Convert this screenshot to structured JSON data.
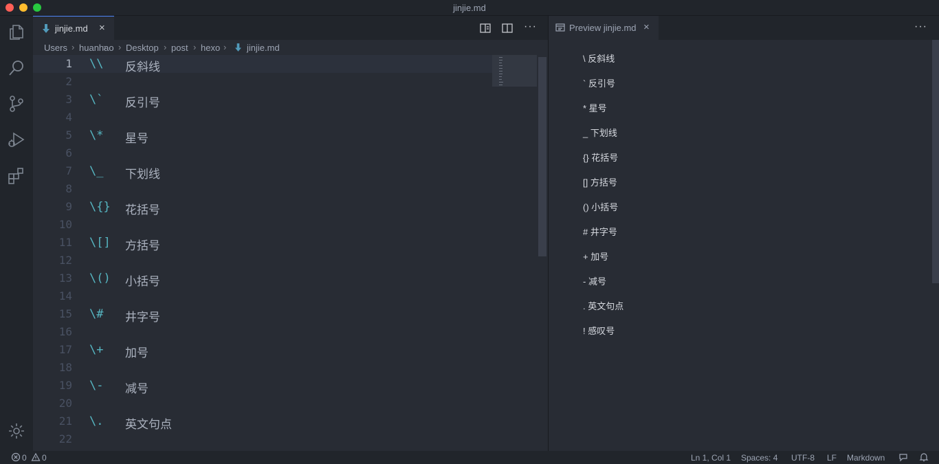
{
  "window": {
    "title": "jinjie.md"
  },
  "activity_bar": {
    "items": [
      "explorer-icon",
      "search-icon",
      "source-control-icon",
      "run-debug-icon",
      "extensions-icon"
    ],
    "bottom": "settings-gear-icon"
  },
  "editor": {
    "tab": {
      "label": "jinjie.md",
      "close": "×"
    },
    "more": "···",
    "breadcrumb": [
      "Users",
      "huanhao",
      "Desktop",
      "post",
      "hexo",
      "jinjie.md"
    ],
    "lines": [
      {
        "n": "1",
        "esc": "\\\\",
        "text": "反斜线"
      },
      {
        "n": "2",
        "esc": "",
        "text": ""
      },
      {
        "n": "3",
        "esc": "\\`",
        "text": "反引号"
      },
      {
        "n": "4",
        "esc": "",
        "text": ""
      },
      {
        "n": "5",
        "esc": "\\*",
        "text": "星号"
      },
      {
        "n": "6",
        "esc": "",
        "text": ""
      },
      {
        "n": "7",
        "esc": "\\_",
        "text": "下划线"
      },
      {
        "n": "8",
        "esc": "",
        "text": ""
      },
      {
        "n": "9",
        "esc": "\\{}",
        "text": "花括号"
      },
      {
        "n": "10",
        "esc": "",
        "text": ""
      },
      {
        "n": "11",
        "esc": "\\[]",
        "text": "方括号"
      },
      {
        "n": "12",
        "esc": "",
        "text": ""
      },
      {
        "n": "13",
        "esc": "\\()",
        "text": "小括号"
      },
      {
        "n": "14",
        "esc": "",
        "text": ""
      },
      {
        "n": "15",
        "esc": "\\#",
        "text": "井字号"
      },
      {
        "n": "16",
        "esc": "",
        "text": ""
      },
      {
        "n": "17",
        "esc": "\\+",
        "text": "加号"
      },
      {
        "n": "18",
        "esc": "",
        "text": ""
      },
      {
        "n": "19",
        "esc": "\\-",
        "text": "减号"
      },
      {
        "n": "20",
        "esc": "",
        "text": ""
      },
      {
        "n": "21",
        "esc": "\\.",
        "text": "英文句点"
      },
      {
        "n": "22",
        "esc": "",
        "text": ""
      }
    ]
  },
  "preview": {
    "tab": {
      "label": "Preview jinjie.md",
      "close": "×"
    },
    "more": "···",
    "items": [
      "\\ 反斜线",
      "` 反引号",
      "* 星号",
      "_ 下划线",
      "{} 花括号",
      "[] 方括号",
      "() 小括号",
      "# 井字号",
      "+ 加号",
      "- 减号",
      ". 英文句点",
      "! 感叹号"
    ]
  },
  "status": {
    "errors": "0",
    "warnings": "0",
    "position": "Ln 1, Col 1",
    "spaces": "Spaces: 4",
    "encoding": "UTF-8",
    "eol": "LF",
    "language": "Markdown"
  },
  "colors": {
    "accent": "#528bff",
    "escape": "#56b6c2",
    "background": "#282c34"
  }
}
